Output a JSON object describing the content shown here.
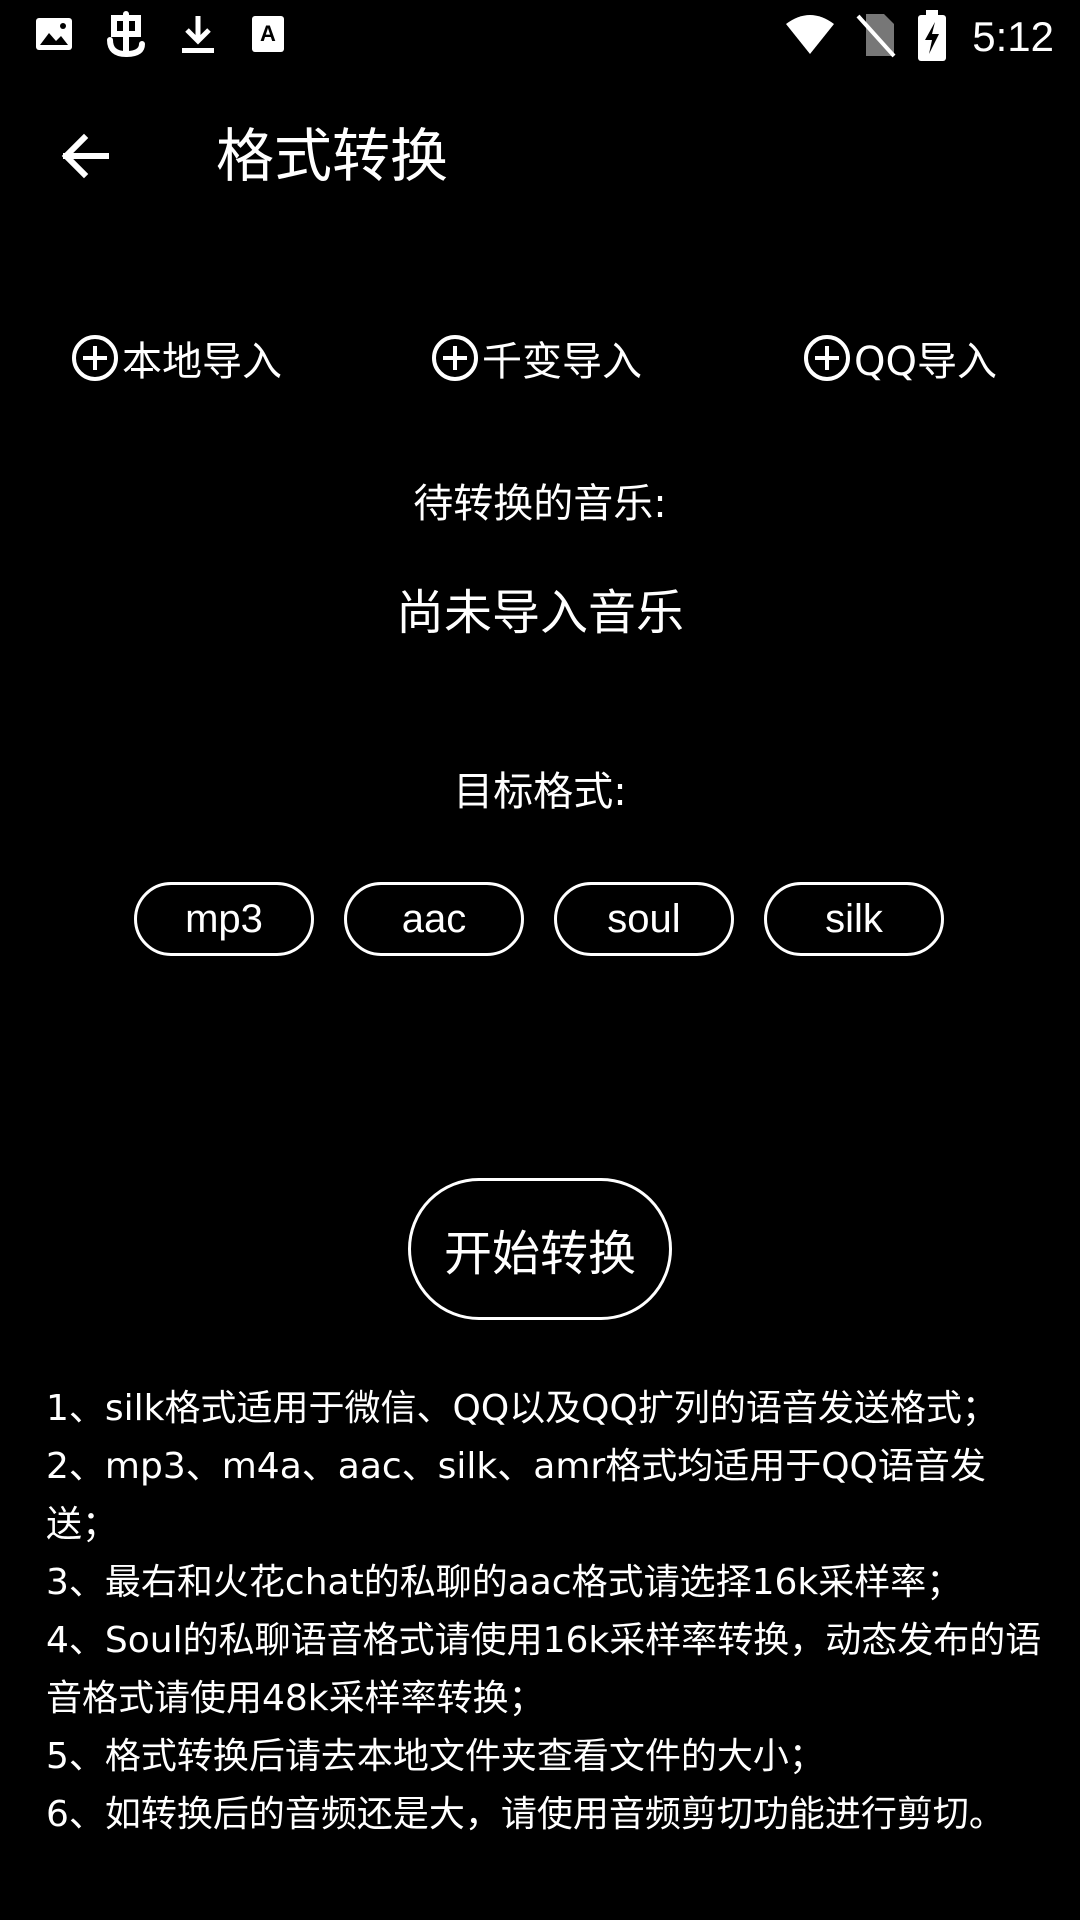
{
  "status_bar": {
    "time": "5:12",
    "left_icons": [
      "image-icon",
      "app-notification-icon",
      "download-icon",
      "text-app-icon"
    ],
    "right_icons": [
      "wifi-icon",
      "no-sim-icon",
      "battery-charging-icon"
    ]
  },
  "app_bar": {
    "back_icon": "arrow-back-icon",
    "title": "格式转换"
  },
  "import_buttons": [
    {
      "label": "本地导入",
      "icon": "add-circle-icon"
    },
    {
      "label": "千变导入",
      "icon": "add-circle-icon"
    },
    {
      "label": "QQ导入",
      "icon": "add-circle-icon"
    }
  ],
  "source": {
    "label": "待转换的音乐:",
    "value": "尚未导入音乐"
  },
  "target": {
    "label": "目标格式:",
    "formats": [
      "mp3",
      "aac",
      "soul",
      "silk"
    ]
  },
  "start_button": {
    "label": "开始转换"
  },
  "notes": [
    "1、silk格式适用于微信、QQ以及QQ扩列的语音发送格式；",
    "2、mp3、m4a、aac、silk、amr格式均适用于QQ语音发送；",
    "3、最右和火花chat的私聊的aac格式请选择16k采样率；",
    "4、Soul的私聊语音格式请使用16k采样率转换，动态发布的语音格式请使用48k采样率转换；",
    "5、格式转换后请去本地文件夹查看文件的大小；",
    "6、如转换后的音频还是大，请使用音频剪切功能进行剪切。"
  ],
  "colors": {
    "background": "#000000",
    "foreground": "#ffffff"
  }
}
